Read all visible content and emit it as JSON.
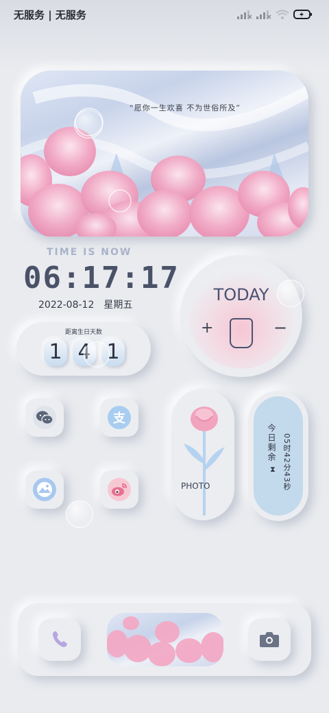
{
  "status_bar": {
    "carrier": "无服务 | 无服务"
  },
  "banner": {
    "quote": "“愿你一生欢喜  不为世俗所及”"
  },
  "clock": {
    "label": "TIME IS NOW",
    "time": "06:17:17",
    "date": "2022-08-12",
    "weekday": "星期五"
  },
  "birthday": {
    "title": "距离生日天数",
    "digits": [
      "1",
      "4",
      "1"
    ]
  },
  "today": {
    "title": "TODAY",
    "plus": "+",
    "minus": "−"
  },
  "apps": [
    {
      "name": "WeChat",
      "icon": "wechat-icon"
    },
    {
      "name": "Alipay",
      "icon": "alipay-icon",
      "glyph": "支"
    },
    {
      "name": "Gallery",
      "icon": "gallery-icon"
    },
    {
      "name": "Weibo",
      "icon": "weibo-icon"
    }
  ],
  "photo": {
    "label": "PHOTO"
  },
  "countdown": {
    "line1": "今日剩余",
    "remaining": "05时42分43秒"
  },
  "dock": {
    "phone_icon": "phone-icon",
    "camera_icon": "camera-icon"
  },
  "colors": {
    "background": "#e9ebef",
    "accent_pink": "#f3a9c0",
    "accent_blue": "#c3d9ec"
  }
}
